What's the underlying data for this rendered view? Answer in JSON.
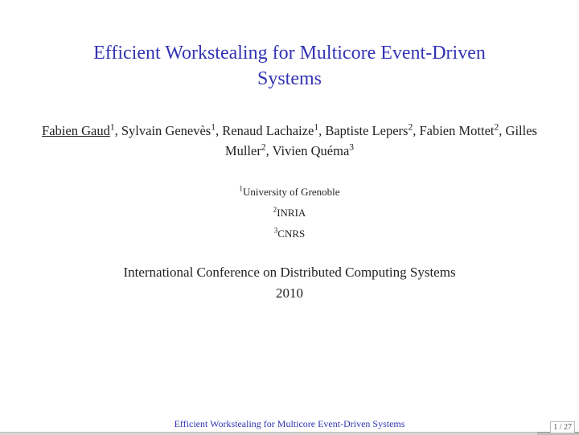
{
  "title_line1": "Efficient Workstealing for Multicore Event-Driven",
  "title_line2": "Systems",
  "authors": {
    "a1_name": "Fabien Gaud",
    "a1_sup": "1",
    "a2_name": "Sylvain Genevès",
    "a2_sup": "1",
    "a3_name": "Renaud Lachaize",
    "a3_sup": "1",
    "a4_name": "Baptiste Lepers",
    "a4_sup": "2",
    "a5_name": "Fabien Mottet",
    "a5_sup": "2",
    "a6_name": "Gilles Muller",
    "a6_sup": "2",
    "a7_name": "Vivien Quéma",
    "a7_sup": "3"
  },
  "affiliations": {
    "aff1_sup": "1",
    "aff1": "University of Grenoble",
    "aff2_sup": "2",
    "aff2": "INRIA",
    "aff3_sup": "3",
    "aff3": "CNRS"
  },
  "conference_line1": "International Conference on Distributed Computing Systems",
  "conference_line2": "2010",
  "footer_title": "Efficient Workstealing for Multicore Event-Driven Systems",
  "page_current": "1",
  "page_sep": " / ",
  "page_total": "27"
}
